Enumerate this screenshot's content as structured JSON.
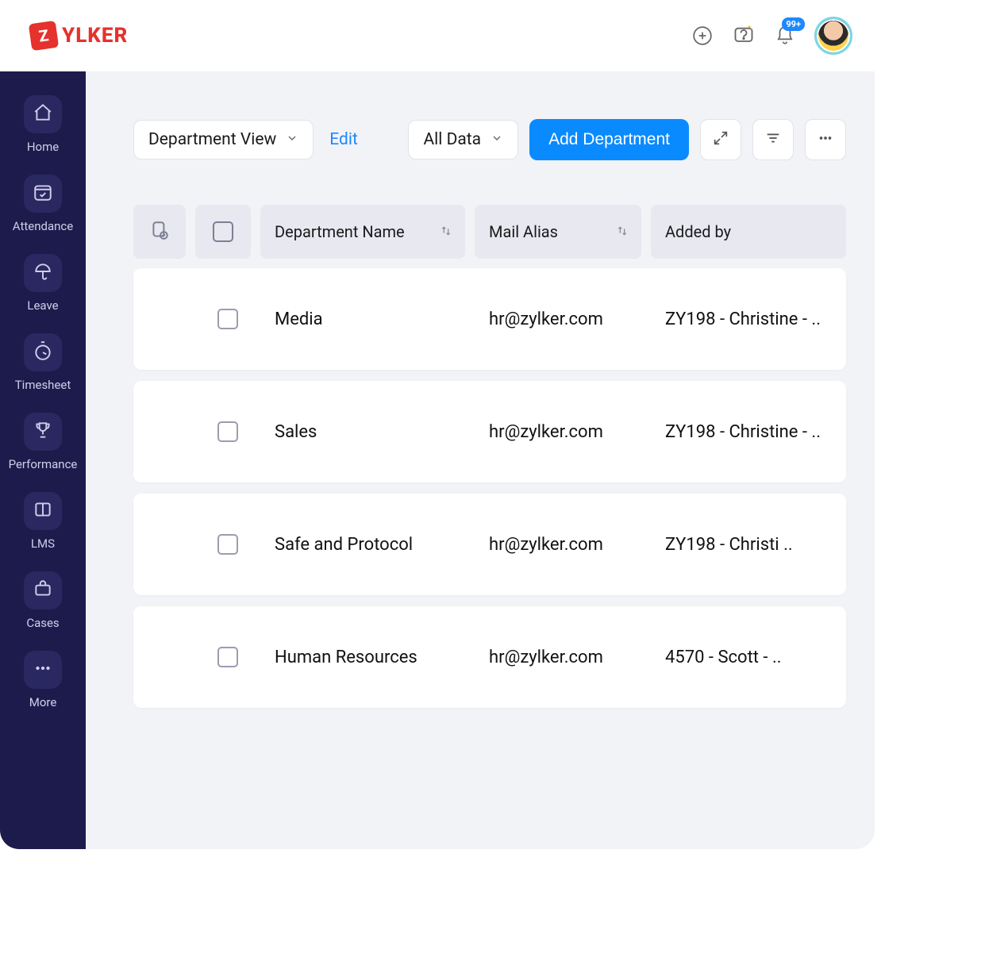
{
  "brand": {
    "badge_letter": "Z",
    "name_text": "YLKER"
  },
  "header": {
    "notification_badge": "99+"
  },
  "sidebar": {
    "items": [
      {
        "label": "Home"
      },
      {
        "label": "Attendance"
      },
      {
        "label": "Leave"
      },
      {
        "label": "Timesheet"
      },
      {
        "label": "Performance"
      },
      {
        "label": "LMS"
      },
      {
        "label": "Cases"
      },
      {
        "label": "More"
      }
    ]
  },
  "toolbar": {
    "view_selector_label": "Department View",
    "edit_label": "Edit",
    "data_filter_label": "All Data",
    "add_button_label": "Add Department"
  },
  "table": {
    "columns": {
      "department_name": "Department Name",
      "mail_alias": "Mail Alias",
      "added_by": "Added by"
    },
    "rows": [
      {
        "name": "Media",
        "mail": "hr@zylker.com",
        "added_by": "ZY198 - Christine - .."
      },
      {
        "name": "Sales",
        "mail": "hr@zylker.com",
        "added_by": "ZY198 - Christine - .."
      },
      {
        "name": "Safe and Protocol",
        "mail": "hr@zylker.com",
        "added_by": "ZY198 - Christi .."
      },
      {
        "name": "Human Resources",
        "mail": "hr@zylker.com",
        "added_by": "4570 - Scott - .."
      }
    ]
  }
}
